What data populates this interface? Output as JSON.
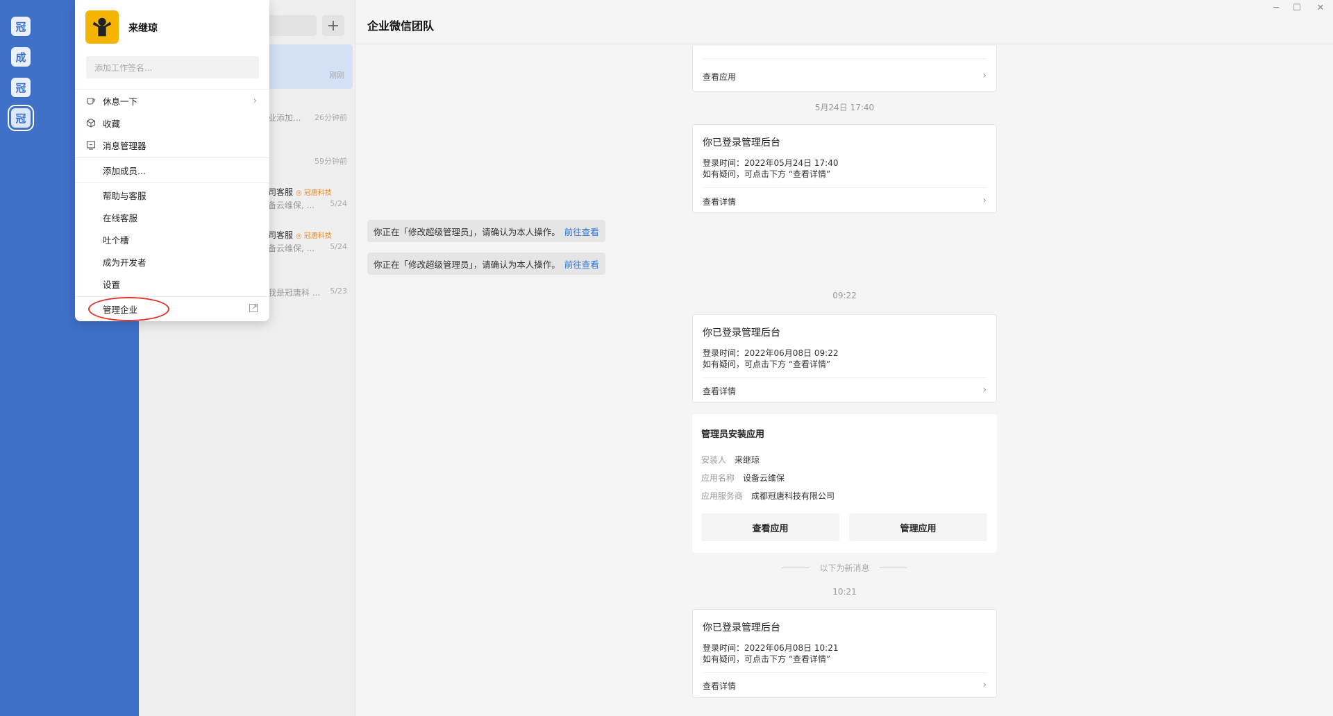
{
  "enterprises": [
    {
      "char": "冠"
    },
    {
      "char": "成"
    },
    {
      "char": "冠"
    },
    {
      "char": "冠",
      "selected": true
    }
  ],
  "nav": {
    "icons": [
      "chat-icon",
      "mail-icon",
      "workbench-icon",
      "calendar-icon",
      "docs-icon",
      "apps-icon",
      "org-chart-icon",
      "settings-gear-icon"
    ]
  },
  "conversation_list": {
    "add_label": "+",
    "items": [
      {
        "name": "",
        "preview": "",
        "time": "刚刚"
      },
      {
        "name": "",
        "preview": "业添加...",
        "time": "26分钟前"
      },
      {
        "name": "",
        "preview": "",
        "time": "59分钟前"
      },
      {
        "name": "司客服",
        "tag": "◎ 冠唐科技",
        "preview": "备云维保, ...",
        "time": "5/24"
      },
      {
        "name": "司客服",
        "tag": "◎ 冠唐科技",
        "preview": "备云维保, ...",
        "time": "5/24"
      },
      {
        "name": "",
        "preview": "我是冠唐科 ...",
        "time": "5/23"
      }
    ]
  },
  "chat": {
    "title": "企业微信团队",
    "window_controls": [
      "─",
      "☐",
      "✕"
    ],
    "top_card_link": "查看应用",
    "stamp_1": "5月24日 17:40",
    "login_card_1": {
      "title": "你已登录管理后台",
      "time_line": "登录时间：2022年05月24日 17:40",
      "hint_line": "如有疑问，可点击下方 “查看详情”",
      "link": "查看详情"
    },
    "system_msgs": [
      {
        "text": "你正在「修改超级管理员」，请确认为本人操作。",
        "link": "前往查看"
      },
      {
        "text": "你正在「修改超级管理员」，请确认为本人操作。",
        "link": "前往查看"
      }
    ],
    "stamp_2": "09:22",
    "login_card_2": {
      "title": "你已登录管理后台",
      "time_line": "登录时间：2022年06月08日 09:22",
      "hint_line": "如有疑问，可点击下方 “查看详情”",
      "link": "查看详情"
    },
    "install_card": {
      "title": "管理员安装应用",
      "rows": [
        {
          "key": "安装人",
          "value": "来继琼"
        },
        {
          "key": "应用名称",
          "value": "设备云维保"
        },
        {
          "key": "应用服务商",
          "value": "成都冠唐科技有限公司"
        }
      ],
      "btn_view": "查看应用",
      "btn_manage": "管理应用"
    },
    "new_msg_divider": "以下为新消息",
    "stamp_3": "10:21",
    "login_card_3": {
      "title": "你已登录管理后台",
      "time_line": "登录时间：2022年06月08日 10:21",
      "hint_line": "如有疑问，可点击下方 “查看详情”",
      "link": "查看详情"
    }
  },
  "menu": {
    "user_name": "来继琼",
    "signature_placeholder": "添加工作签名...",
    "items": [
      {
        "label": "休息一下",
        "icon": "coffee-cup-icon",
        "arrow": "›"
      },
      {
        "label": "收藏",
        "icon": "cube-icon"
      },
      {
        "label": "消息管理器",
        "icon": "message-manager-icon"
      },
      {
        "label": "添加成员..."
      },
      {
        "label": "帮助与客服"
      },
      {
        "label": "在线客服"
      },
      {
        "label": "吐个槽"
      },
      {
        "label": "成为开发者"
      },
      {
        "label": "设置"
      },
      {
        "label": "管理企业",
        "icon_right": "external-link-icon"
      }
    ]
  },
  "colors": {
    "sidebar": "#3f71c9",
    "link": "#2f74d6",
    "highlight": "#e0322c",
    "avatar": "#f5b400"
  }
}
